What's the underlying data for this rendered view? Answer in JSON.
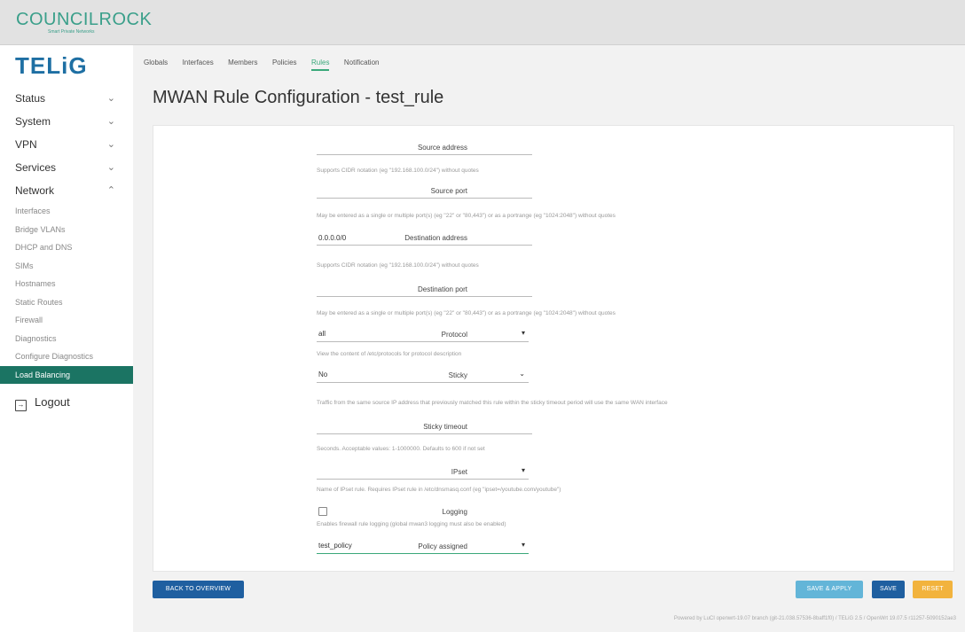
{
  "brand": {
    "name": "COUNCILROCK",
    "tagline": "Smart Private Networks",
    "product": "TELiG"
  },
  "sidebar": {
    "menu": [
      {
        "label": "Status",
        "chevron": "chevron-down-icon"
      },
      {
        "label": "System",
        "chevron": "chevron-down-icon"
      },
      {
        "label": "VPN",
        "chevron": "chevron-down-icon"
      },
      {
        "label": "Services",
        "chevron": "chevron-down-icon"
      },
      {
        "label": "Network",
        "chevron": "chevron-up-icon"
      }
    ],
    "network_items": [
      "Interfaces",
      "Bridge VLANs",
      "DHCP and DNS",
      "SIMs",
      "Hostnames",
      "Static Routes",
      "Firewall",
      "Diagnostics",
      "Configure Diagnostics",
      "Load Balancing"
    ],
    "active_item": "Load Balancing",
    "logout": "Logout"
  },
  "tabs": [
    "Globals",
    "Interfaces",
    "Members",
    "Policies",
    "Rules",
    "Notification"
  ],
  "active_tab": "Rules",
  "page_title": "MWAN Rule Configuration - test_rule",
  "form": {
    "source_address": {
      "label": "Source address",
      "value": "",
      "hint": "Supports CIDR notation (eg \"192.168.100.0/24\") without quotes"
    },
    "source_port": {
      "label": "Source port",
      "value": "",
      "hint": "May be entered as a single or multiple port(s) (eg \"22\" or \"80,443\") or as a portrange (eg \"1024:2048\") without quotes"
    },
    "destination_address": {
      "label": "Destination address",
      "value": "0.0.0.0/0",
      "hint": "Supports CIDR notation (eg \"192.168.100.0/24\") without quotes"
    },
    "destination_port": {
      "label": "Destination port",
      "value": "",
      "hint": "May be entered as a single or multiple port(s) (eg \"22\" or \"80,443\") or as a portrange (eg \"1024:2048\") without quotes"
    },
    "protocol": {
      "label": "Protocol",
      "value": "all",
      "hint": "View the content of /etc/protocols for protocol description"
    },
    "sticky": {
      "label": "Sticky",
      "value": "No",
      "hint": "Traffic from the same source IP address that previously matched this rule within the sticky timeout period will use the same WAN interface"
    },
    "sticky_timeout": {
      "label": "Sticky timeout",
      "value": "",
      "hint": "Seconds. Acceptable values: 1-1000000. Defaults to 600 if not set"
    },
    "ipset": {
      "label": "IPset",
      "value": "",
      "hint": "Name of IPset rule. Requires IPset rule in /etc/dnsmasq.conf (eg \"ipset=/youtube.com/youtube\")"
    },
    "logging": {
      "label": "Logging",
      "checked": false,
      "hint": "Enables firewall rule logging (global mwan3 logging must also be enabled)"
    },
    "policy_assigned": {
      "label": "Policy assigned",
      "value": "test_policy"
    }
  },
  "buttons": {
    "back": "BACK TO OVERVIEW",
    "save_apply": "SAVE & APPLY",
    "save": "SAVE",
    "reset": "RESET"
  },
  "footer": "Powered by LuCI openwrt-19.07 branch (git-21.038.57536-8baff1f0) / TELiG 2.5 / OpenWrt 19.07.5 r11257-5090152ae3",
  "colors": {
    "accent": "#3aa87a",
    "active_menu": "#1b7463",
    "primary_button": "#1f5fa0",
    "save_apply_button": "#63b5d8",
    "reset_button": "#f2b33d",
    "product_logo": "#1e6fa3"
  }
}
